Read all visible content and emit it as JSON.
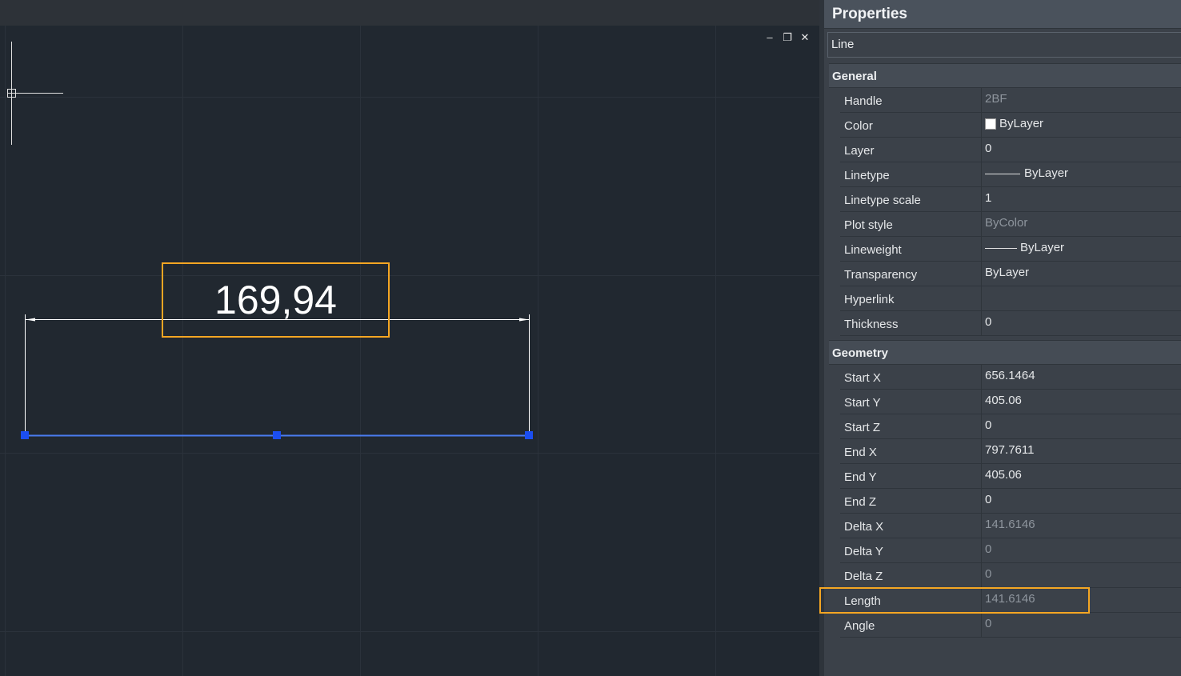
{
  "viewport": {
    "window_controls": {
      "minimize": "–",
      "restore": "❐",
      "close": "✕"
    },
    "dimension_text": "169,94",
    "colors": {
      "background": "#212830",
      "grid": "#2b323b",
      "selected_line": "#4a7cf0",
      "grip": "#1b4ef0",
      "dimension": "#ffffff",
      "highlight": "#f5a623"
    }
  },
  "properties": {
    "title": "Properties",
    "entity_type": "Line",
    "sections": [
      {
        "title": "General",
        "rows": [
          {
            "name": "Handle",
            "value": "2BF",
            "readonly": true
          },
          {
            "name": "Color",
            "value": "ByLayer",
            "swatch": "white-swatch"
          },
          {
            "name": "Layer",
            "value": "0"
          },
          {
            "name": "Linetype",
            "value": "ByLayer",
            "line": "linetype"
          },
          {
            "name": "Linetype scale",
            "value": "1"
          },
          {
            "name": "Plot style",
            "value": "ByColor",
            "readonly": true
          },
          {
            "name": "Lineweight",
            "value": "ByLayer",
            "line": "lineweight"
          },
          {
            "name": "Transparency",
            "value": "ByLayer"
          },
          {
            "name": "Hyperlink",
            "value": ""
          },
          {
            "name": "Thickness",
            "value": "0"
          }
        ]
      },
      {
        "title": "Geometry",
        "rows": [
          {
            "name": "Start X",
            "value": "656.1464"
          },
          {
            "name": "Start Y",
            "value": "405.06"
          },
          {
            "name": "Start Z",
            "value": "0"
          },
          {
            "name": "End X",
            "value": "797.7611"
          },
          {
            "name": "End Y",
            "value": "405.06"
          },
          {
            "name": "End Z",
            "value": "0"
          },
          {
            "name": "Delta X",
            "value": "141.6146",
            "readonly": true
          },
          {
            "name": "Delta Y",
            "value": "0",
            "readonly": true
          },
          {
            "name": "Delta Z",
            "value": "0",
            "readonly": true
          },
          {
            "name": "Length",
            "value": "141.6146",
            "readonly": true,
            "highlighted": true
          },
          {
            "name": "Angle",
            "value": "0",
            "readonly": true
          }
        ]
      }
    ]
  }
}
